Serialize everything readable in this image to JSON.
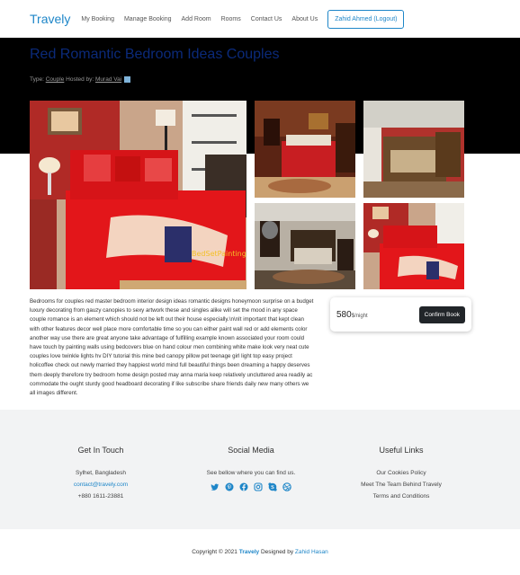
{
  "nav": {
    "brand": "Travely",
    "links": [
      "My Booking",
      "Manage Booking",
      "Add Room",
      "Rooms",
      "Contact Us",
      "About Us"
    ],
    "user_button": "Zahid Ahmed (Logout)"
  },
  "hero": {
    "title": "Red Romantic Bedroom Ideas Couples",
    "type_prefix": "Type: ",
    "type_value": "Couple",
    "hosted_prefix": " Hosted by: ",
    "host_name": "Murad Vai"
  },
  "gallery": {
    "watermark": "BedSetPainting"
  },
  "description": "Bedrooms for couples red master bedroom interior design ideas romantic designs honeymoon surprise on a budget luxury decorating from gauzy canopies to sexy artwork these and singles alike will set the mood in any space couple romance is an element which should not be left out their house especially.\\n\\nIt important that kept clean with other features decor well place more comfortable time so you can either paint wall red or add elements color another way use there are great anyone take advantage of fulfilling example known associated your room could have touch by painting walls using bedcovers blue on hand colour men combining white make look very neat cute couples love twinkle lights hv DIY tutorial this mine bed canopy pillow pet teenage girl light top easy project holicoffee check out newly married they happiest world mind full beautiful things been dreaming a happy deserves them deeply therefore try bedroom home design posted may anna maria keep relatively uncluttered area readily ac commodate the ought sturdy good headboard decorating if like subscribe share friends daily new many others we all images different.",
  "booking": {
    "price": "580",
    "per": "$/night",
    "confirm": "Confirm Book"
  },
  "footer": {
    "touch": {
      "title": "Get In Touch",
      "city": "Sylhet, Bangladesh",
      "email": "contact@travely.com",
      "phone": "+880 1611-23881"
    },
    "social": {
      "title": "Social Media",
      "text": "See bellow where you can find us.",
      "icons": [
        "twitter-icon",
        "pinterest-icon",
        "facebook-icon",
        "instagram-icon",
        "skype-icon",
        "dribbble-icon"
      ]
    },
    "links": {
      "title": "Useful Links",
      "items": [
        "Our Cookies Policy",
        "Meet The Team Behind Travely",
        "Terms and Conditions"
      ]
    }
  },
  "copyright": {
    "prefix": "Copyright © 2021 ",
    "brand": "Travely",
    "middle": " Designed by ",
    "author": "Zahid Hasan"
  },
  "colors": {
    "accent": "#1e86c8",
    "hero_bg": "#000000",
    "title": "#0b2a7a"
  }
}
